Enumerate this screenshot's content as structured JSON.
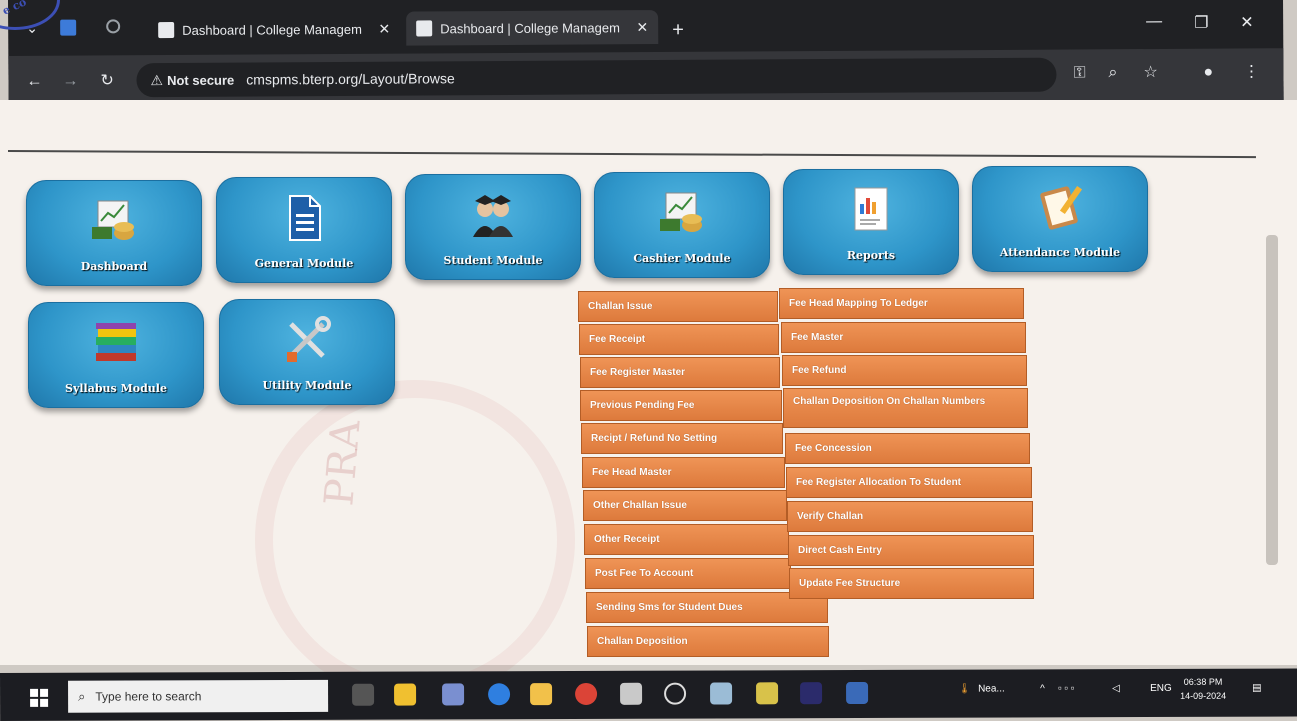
{
  "browser": {
    "tabs": [
      {
        "title": "Dashboard | College Managem",
        "active": false
      },
      {
        "title": "Dashboard | College Managem",
        "active": true
      }
    ],
    "new_tab": "+",
    "address": {
      "security": "Not secure",
      "url": "cmspms.bterp.org/Layout/Browse"
    }
  },
  "modules_row1": [
    {
      "label": "Dashboard",
      "icon": "dashboard-icon"
    },
    {
      "label": "General Module",
      "icon": "document-icon"
    },
    {
      "label": "Student Module",
      "icon": "students-icon"
    },
    {
      "label": "Cashier Module",
      "icon": "cashier-icon"
    },
    {
      "label": "Reports",
      "icon": "report-icon"
    },
    {
      "label": "Attendance Module",
      "icon": "clipboard-icon"
    }
  ],
  "modules_row2": [
    {
      "label": "Syllabus Module",
      "icon": "books-icon"
    },
    {
      "label": "Utility Module",
      "icon": "tools-icon"
    }
  ],
  "cashier_menu": {
    "left": [
      "Challan Issue",
      "Fee Receipt",
      "Fee Register Master",
      "Previous Pending Fee",
      "Recipt / Refund No Setting",
      "Fee Head Master",
      "Other Challan Issue",
      "Other Receipt",
      "Post Fee To Account",
      "Sending Sms for Student Dues",
      "Challan Deposition"
    ],
    "right": [
      "Fee Head Mapping To Ledger",
      "Fee Master",
      "Fee Refund",
      "Challan Deposition On Challan Numbers",
      "Fee Concession",
      "Fee Register Allocation To Student",
      "Verify Challan",
      "Direct Cash Entry",
      "Update Fee Structure"
    ]
  },
  "watermark": "PRA",
  "stamp": "e co",
  "taskbar": {
    "search_placeholder": "Type here to search",
    "weather": "Nea...",
    "language": "ENG",
    "time": "06:38 PM",
    "date": "14-09-2024"
  },
  "colors": {
    "tile": "#2e95c9",
    "menu": "#e7874a",
    "page_bg": "#f6f1ec"
  }
}
